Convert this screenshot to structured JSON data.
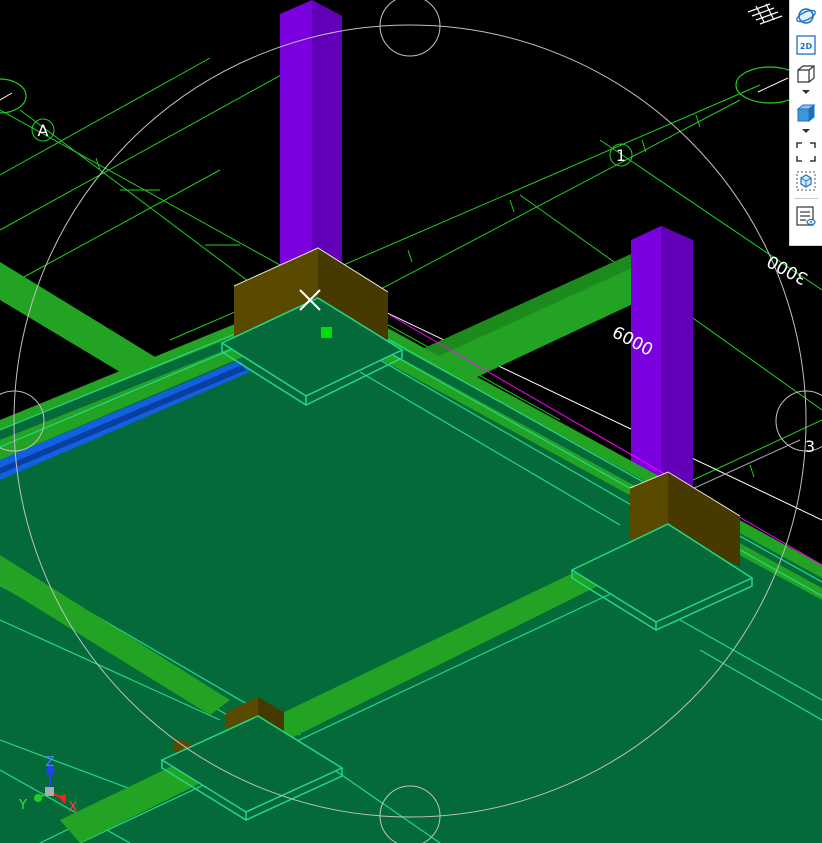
{
  "viewport": {
    "background": "#000000",
    "labels": {
      "grid_a": "A",
      "grid_1": "1",
      "grid_3": "3",
      "dim_6000": "6000",
      "dim_3000_rotated": "3000"
    },
    "colors": {
      "slab": "#046a3a",
      "slab_edge": "#22d88a",
      "beam": "#23a323",
      "column": "#7a00e0",
      "column_cap": "#5a4a00",
      "grid_line": "#1fd01f",
      "orbit_ring": "#c0c0c0",
      "selected_line": "#ff00ff",
      "blue_beam": "#1060e0"
    }
  },
  "axis_indicator": {
    "x": "X",
    "y": "Y",
    "z": "Z"
  },
  "toolbar": {
    "buttons": [
      {
        "name": "orbit-icon"
      },
      {
        "name": "2d-view-icon",
        "label": "2D"
      },
      {
        "name": "wireframe-cube-icon"
      },
      {
        "name": "shaded-cube-icon"
      },
      {
        "name": "fit-extents-icon"
      },
      {
        "name": "isolate-object-icon"
      },
      {
        "name": "properties-list-icon"
      }
    ],
    "accent": "#1a73c8"
  }
}
